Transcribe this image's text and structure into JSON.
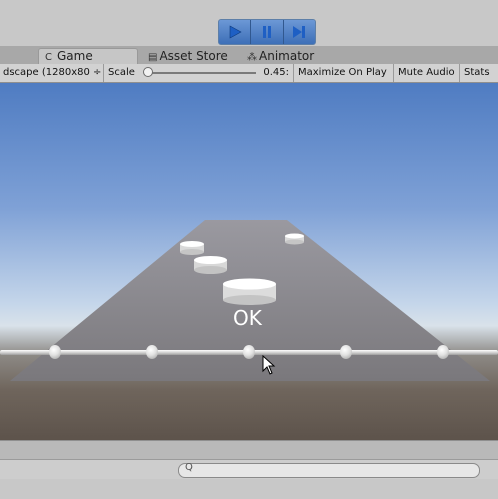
{
  "toolbar": {
    "play_icon": "play-icon",
    "pause_icon": "pause-icon",
    "step_icon": "step-icon"
  },
  "tabs": [
    {
      "icon": "game-icon",
      "glyph": "C",
      "label": "Game",
      "active": true
    },
    {
      "icon": "asset-store-icon",
      "glyph": "▤",
      "label": "Asset Store",
      "active": false
    },
    {
      "icon": "animator-icon",
      "glyph": "⁂",
      "label": "Animator",
      "active": false
    }
  ],
  "game_toolbar": {
    "resolution": "dscape (1280x80 ÷",
    "scale_label": "Scale",
    "scale_value": "0.45:",
    "maximize_label": "Maximize On Play",
    "mute_label": "Mute Audio",
    "stats_label": "Stats"
  },
  "scene": {
    "ok_text": "OK"
  },
  "console": {
    "search_icon": "search-icon",
    "search_glyph": "Q"
  },
  "colors": {
    "play_accent": "#4a7bc4",
    "sky_top": "#4f7cc2",
    "ground": "#6f655c"
  }
}
